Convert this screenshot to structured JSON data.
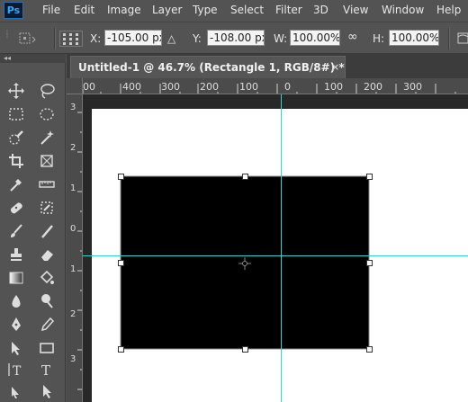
{
  "app": {
    "logo_text": "Ps"
  },
  "menu": [
    "File",
    "Edit",
    "Image",
    "Layer",
    "Type",
    "Select",
    "Filter",
    "3D",
    "View",
    "Window",
    "Help"
  ],
  "options": {
    "x_label": "X:",
    "x_value": "-105.00 px",
    "y_label": "Y:",
    "y_value": "-108.00 px",
    "w_label": "W:",
    "w_value": "100.00%",
    "h_label": "H:",
    "h_value": "100.00%",
    "delta_glyph": "△",
    "link_glyph": "∞"
  },
  "document": {
    "tab_title": "Untitled-1 @ 46.7% (Rectangle 1, RGB/8#) *",
    "close_glyph": "×"
  },
  "rulers": {
    "horizontal": [
      "00",
      "400",
      "300",
      "200",
      "100",
      "0",
      "100",
      "200",
      "300"
    ],
    "vertical": [
      "3",
      "2",
      "1",
      "0",
      "1",
      "2",
      "3",
      "0",
      "1",
      "2",
      "3",
      "0",
      "1"
    ]
  },
  "tools": [
    "move-tool",
    "lasso-tool",
    "rect-marquee-tool",
    "ellipse-marquee-tool",
    "quick-select-tool",
    "magic-wand-tool",
    "crop-tool",
    "perspective-crop-tool",
    "eyedropper-tool",
    "ruler-tool",
    "healing-brush-tool",
    "patch-tool",
    "brush-tool",
    "pencil-tool",
    "clone-stamp-tool",
    "history-brush-tool",
    "eraser-tool",
    "magic-eraser-tool",
    "gradient-tool",
    "paint-bucket-tool",
    "blur-tool",
    "smudge-tool",
    "sharpen-tool",
    "dodge-tool",
    "sponge-tool",
    "pen-tool",
    "horizontal-type-tool",
    "vertical-type-tool",
    "path-select-tool",
    "direct-select-tool"
  ],
  "colors": {
    "accent": "#31a8ff",
    "guide": "#35d0d0",
    "shape_fill": "#000000"
  }
}
